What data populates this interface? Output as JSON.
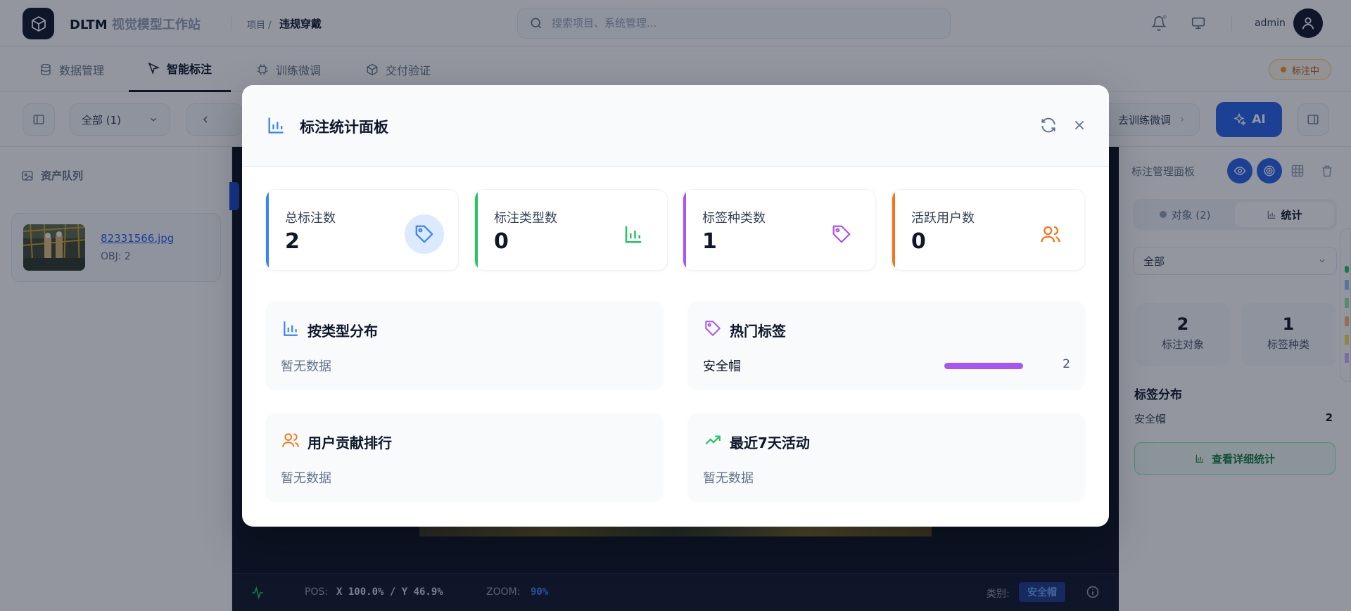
{
  "header": {
    "brand_main": "DLTM",
    "brand_sub": "视觉模型工作站",
    "breadcrumb_prefix": "项目 /",
    "breadcrumb_current": "违规穿戴",
    "search_placeholder": "搜索项目、系统管理...",
    "user": "admin"
  },
  "nav": {
    "tabs": [
      {
        "label": "数据管理",
        "icon": "database-icon"
      },
      {
        "label": "智能标注",
        "icon": "cursor-icon",
        "active": true
      },
      {
        "label": "训练微调",
        "icon": "cpu-icon"
      },
      {
        "label": "交付验证",
        "icon": "box-icon"
      }
    ],
    "status": "标注中"
  },
  "toolbar": {
    "filter": "全部 (1)",
    "train_link": "去训练微调",
    "ai_label": "AI"
  },
  "left": {
    "title": "资产队列",
    "asset": {
      "name": "82331566.jpg",
      "meta": "OBJ: 2"
    }
  },
  "statusbar": {
    "pos_label": "POS:",
    "pos_value": "X 100.0% / Y 46.9%",
    "zoom_label": "ZOOM:",
    "zoom_value": "90%",
    "class_label": "类别:",
    "class_value": "安全帽"
  },
  "right": {
    "title": "标注管理面板",
    "tab_objects": "对象 (2)",
    "tab_stats": "统计",
    "select_value": "全部",
    "stat1_num": "2",
    "stat1_label": "标注对象",
    "stat2_num": "1",
    "stat2_label": "标签种类",
    "dist_title": "标签分布",
    "dist_name": "安全帽",
    "dist_count": "2",
    "detail_button": "查看详细统计"
  },
  "modal": {
    "title": "标注统计面板",
    "cards": [
      {
        "label": "总标注数",
        "value": "2",
        "color": "#3b82f6",
        "icon": "tag-icon"
      },
      {
        "label": "标注类型数",
        "value": "0",
        "color": "#22c55e",
        "icon": "bar-chart-icon"
      },
      {
        "label": "标签种类数",
        "value": "1",
        "color": "#a855f7",
        "icon": "tag-icon"
      },
      {
        "label": "活跃用户数",
        "value": "0",
        "color": "#f97316",
        "icon": "users-icon"
      }
    ],
    "type_dist": {
      "title": "按类型分布",
      "empty": "暂无数据"
    },
    "hot_tags": {
      "title": "热门标签",
      "items": [
        {
          "name": "安全帽",
          "count": "2",
          "share": 1.0
        }
      ]
    },
    "user_rank": {
      "title": "用户贡献排行",
      "empty": "暂无数据"
    },
    "activity": {
      "title": "最近7天活动",
      "empty": "暂无数据"
    }
  }
}
